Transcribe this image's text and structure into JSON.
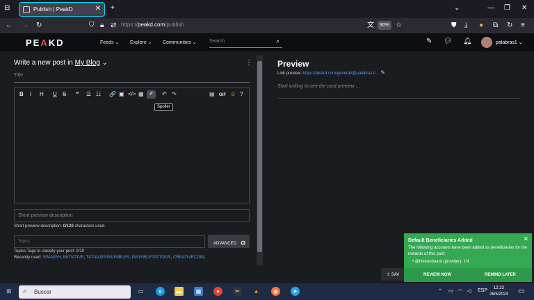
{
  "browser": {
    "tab_title": "Publish | PeakD",
    "url_prefix": "https://",
    "url_host": "peakd.com",
    "url_path": "/publish",
    "zoom": "90%"
  },
  "header": {
    "logo_left": "PE",
    "logo_accent": "A",
    "logo_right": "KD",
    "menu": [
      "Feeds",
      "Explore",
      "Communities"
    ],
    "search_placeholder": "Search",
    "username": "palabras1"
  },
  "editor": {
    "heading_prefix": "Write a new post in",
    "heading_blog": "My Blog",
    "title_placeholder": "Title",
    "toolbar": [
      "B",
      "I",
      "H",
      "U",
      "S",
      "❝",
      "☰",
      "☷",
      "🔗",
      "▣",
      "</>",
      "▦",
      "✐",
      "↶",
      "↷",
      "▤",
      "GIF",
      "☺",
      "?"
    ],
    "tooltip": "Spoiler",
    "desc_placeholder": "Short preview description",
    "desc_hint": "Short preview description:",
    "desc_count": "0/120",
    "desc_suffix": "characters used.",
    "topics_placeholder": "Topics",
    "advanced_label": "ADVANCED",
    "topics_hint": "Topics-Tags to classify your post: 0/10",
    "recent_prefix": "Recently used:",
    "recent_tags": [
      "SPANISH",
      "INITIATIVE",
      "TATUAJESINVISIBLES",
      "INVISIBLETATTOOS",
      "CREATIVECOIN"
    ]
  },
  "preview": {
    "title": "Preview",
    "link_label": "Link preview:",
    "link_url": "https://peakd.com/general/@palabras1/...",
    "empty_text": "Start writing to see the post preview ..."
  },
  "notification": {
    "title": "Default Beneficiaries Added",
    "body": "The following accounts have been added as beneficiaries for the rewards of this post:",
    "item": "@hiveonboard (provider): 1%",
    "review": "REVIEW NOW",
    "later": "REMIND LATER",
    "save": "SAV"
  },
  "taskbar": {
    "search": "Buscar",
    "lang": "ESP",
    "time": "12:23",
    "date": "26/5/2024"
  }
}
